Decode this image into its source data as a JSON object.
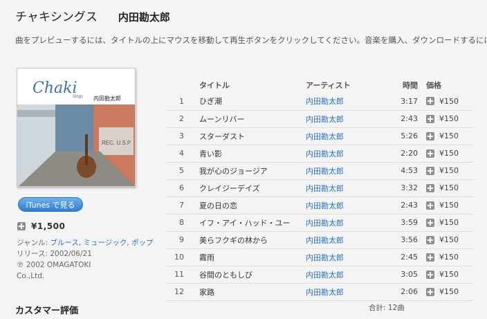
{
  "header": {
    "album_title": "チャキシングス",
    "artist_name": "内田勘太郎"
  },
  "instruction": "曲をプレビューするには、タイトルの上にマウスを移動して再生ボタンをクリックしてください。音楽を購入、ダウンロードするには iTu",
  "cover": {
    "logo_text": "Chaki",
    "logo_sub": "Sings",
    "artist_text": "内田勘太郎",
    "sign_text": "REC. U.S.P"
  },
  "itunes_button": "iTunes で見る",
  "album_price": "¥1,500",
  "meta": {
    "genre_label": "ジャンル: ",
    "genres": [
      "ブルース",
      "ミュージック",
      "ポップ"
    ],
    "release": "リリース: 2002/06/21",
    "copyright_line1": "℗ 2002 OMAGATOKI",
    "copyright_line2": "Co.,Ltd."
  },
  "reviews_heading": "カスタマー評価",
  "table": {
    "headers": {
      "title": "タイトル",
      "artist": "アーティスト",
      "time": "時間",
      "price": "価格"
    },
    "rows": [
      {
        "num": "1",
        "title": "ひぎ潮",
        "artist": "内田勘太郎",
        "time": "3:17",
        "price": "¥150"
      },
      {
        "num": "2",
        "title": "ムーンリバー",
        "artist": "内田勘太郎",
        "time": "2:43",
        "price": "¥150"
      },
      {
        "num": "3",
        "title": "スターダスト",
        "artist": "内田勘太郎",
        "time": "5:26",
        "price": "¥150"
      },
      {
        "num": "4",
        "title": "青い影",
        "artist": "内田勘太郎",
        "time": "2:20",
        "price": "¥150"
      },
      {
        "num": "5",
        "title": "我が心のジョージア",
        "artist": "内田勘太郎",
        "time": "4:53",
        "price": "¥150"
      },
      {
        "num": "6",
        "title": "クレイジーデイズ",
        "artist": "内田勘太郎",
        "time": "3:32",
        "price": "¥150"
      },
      {
        "num": "7",
        "title": "夏の日の恋",
        "artist": "内田勘太郎",
        "time": "2:43",
        "price": "¥150"
      },
      {
        "num": "8",
        "title": "イフ・アイ・ハッド・ユー",
        "artist": "内田勘太郎",
        "time": "3:59",
        "price": "¥150"
      },
      {
        "num": "9",
        "title": "美らフクギの林から",
        "artist": "内田勘太郎",
        "time": "3:56",
        "price": "¥150"
      },
      {
        "num": "10",
        "title": "霧雨",
        "artist": "内田勘太郎",
        "time": "2:45",
        "price": "¥150"
      },
      {
        "num": "11",
        "title": "谷間のともしび",
        "artist": "内田勘太郎",
        "time": "3:05",
        "price": "¥150"
      },
      {
        "num": "12",
        "title": "家路",
        "artist": "内田勘太郎",
        "time": "2:06",
        "price": "¥150"
      }
    ]
  },
  "total": "合計: 12曲",
  "colors": {
    "link": "#2a6fc0",
    "button": "#2f7ed3",
    "background": "#f4f4f4"
  }
}
